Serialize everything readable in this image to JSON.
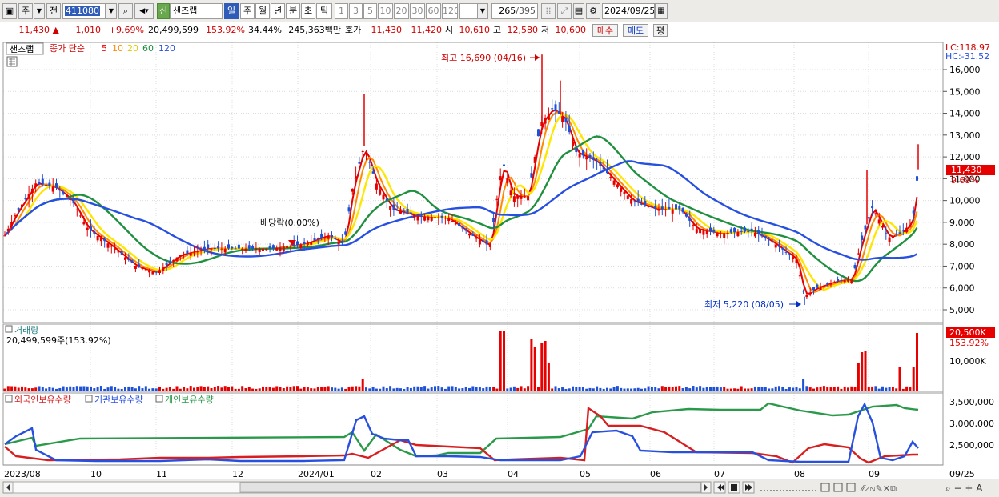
{
  "toolbar": {
    "market": "주",
    "prev_label": "전",
    "code": "411080",
    "badge": "신",
    "name": "샌즈랩",
    "periods": [
      "일",
      "주",
      "월",
      "년",
      "분",
      "초",
      "틱"
    ],
    "active_period": "일",
    "nums": [
      "1",
      "3",
      "5",
      "10",
      "20",
      "30",
      "60",
      "120"
    ],
    "count": "265",
    "total": "/395",
    "date": "2024/09/25"
  },
  "quote": {
    "price": "11,430",
    "arrow": "▲",
    "change": "1,010",
    "rate": "+9.69%",
    "volume": "20,499,599",
    "vol_ratio": "153.92%",
    "turnover": "34.44%",
    "amount": "245,363백만",
    "hoga_label": "호가",
    "ask": "11,430",
    "bid": "11,420",
    "open_label": "시",
    "open": "10,610",
    "high_label": "고",
    "high": "12,580",
    "low_label": "저",
    "low": "10,600",
    "buy_btn": "매수",
    "sell_btn": "매도",
    "eval_btn": "평"
  },
  "price_panel": {
    "name_tag": "샌즈랩",
    "ma_title": "종가 단순",
    "ma": [
      {
        "label": "5",
        "color": "#e60000"
      },
      {
        "label": "10",
        "color": "#ff8a00"
      },
      {
        "label": "20",
        "color": "#f0e000"
      },
      {
        "label": "60",
        "color": "#209040"
      },
      {
        "label": "120",
        "color": "#2850e0"
      }
    ],
    "lc": "LC:118.97",
    "hc": "HC:-31.52",
    "y_ticks": [
      "16,000",
      "15,000",
      "14,000",
      "13,000",
      "12,000",
      "11,000",
      "10,000",
      "9,000",
      "8,000",
      "7,000",
      "6,000",
      "5,000"
    ],
    "price_tag": "11,430",
    "pct_tag": "9.69%",
    "high_note": "최고 16,690 (04/16)",
    "low_note": "최저 5,220 (08/05)",
    "dividend_note": "배당락(0.00%)"
  },
  "volume_panel": {
    "title": "거래량",
    "value": "20,499,599주(153.92%)",
    "tick": "10,000K",
    "tag": "20,500K",
    "tag_pct": "153.92%"
  },
  "holding_panel": {
    "s1": "외국인보유수량",
    "s2": "기관보유수량",
    "s3": "개인보유수량",
    "ticks": [
      "3,500,000",
      "3,000,000",
      "2,500,000"
    ]
  },
  "x_axis": [
    "2023/08",
    "10",
    "11",
    "12",
    "2024/01",
    "02",
    "03",
    "04",
    "05",
    "06",
    "07",
    "08",
    "09",
    "09/25"
  ],
  "colors": {
    "up": "#e60000",
    "down": "#1e50d8",
    "foreign": "#d81e1e",
    "institution": "#2850e0",
    "individual": "#2a9a4a"
  },
  "chart_data": {
    "type": "candlestick",
    "title": "샌즈랩",
    "monthly_closes": [
      {
        "x": "2023/08",
        "close": 9500
      },
      {
        "x": "2023/09",
        "close": 9800
      },
      {
        "x": "2023/10",
        "close": 8200
      },
      {
        "x": "2023/11",
        "close": 7200
      },
      {
        "x": "2023/12",
        "close": 7700
      },
      {
        "x": "2024/01",
        "close": 8100
      },
      {
        "x": "2024/02",
        "close": 9200
      },
      {
        "x": "2024/03",
        "close": 8300
      },
      {
        "x": "2024/04",
        "close": 14000
      },
      {
        "x": "2024/05",
        "close": 11200
      },
      {
        "x": "2024/06",
        "close": 9500
      },
      {
        "x": "2024/07",
        "close": 8500
      },
      {
        "x": "2024/08",
        "close": 6100
      },
      {
        "x": "2024/09",
        "close": 11430
      }
    ],
    "high": {
      "value": 16690,
      "date": "04/16"
    },
    "low": {
      "value": 5220,
      "date": "08/05"
    },
    "last_close": 11430,
    "ylim": [
      5000,
      16000
    ]
  }
}
